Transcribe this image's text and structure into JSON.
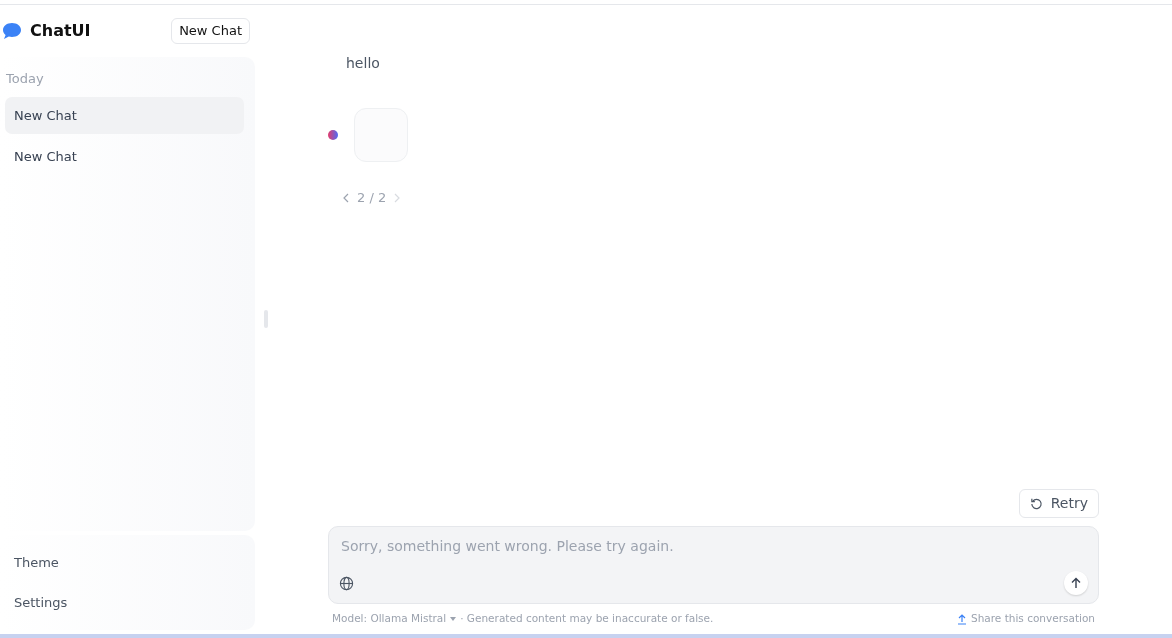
{
  "app": {
    "name": "ChatUI"
  },
  "new_chat_button": "New Chat",
  "sidebar": {
    "group": "Today",
    "items": [
      {
        "label": "New Chat",
        "selected": true
      },
      {
        "label": "New Chat",
        "selected": false
      }
    ],
    "bottom_items": [
      "Theme",
      "Settings"
    ]
  },
  "messages": [
    {
      "kind": "user",
      "text": "hello"
    },
    {
      "kind": "assistant"
    }
  ],
  "pager": {
    "text": "2 / 2",
    "prev_disabled": false,
    "next_disabled": true
  },
  "retry_button": "Retry",
  "input": {
    "placeholder": "Sorry, something went wrong. Please try again."
  },
  "footer": {
    "model": "Model: Ollama Mistral",
    "disclaimer": "· Generated content may be inaccurate or false.",
    "share": "Share this conversation"
  }
}
